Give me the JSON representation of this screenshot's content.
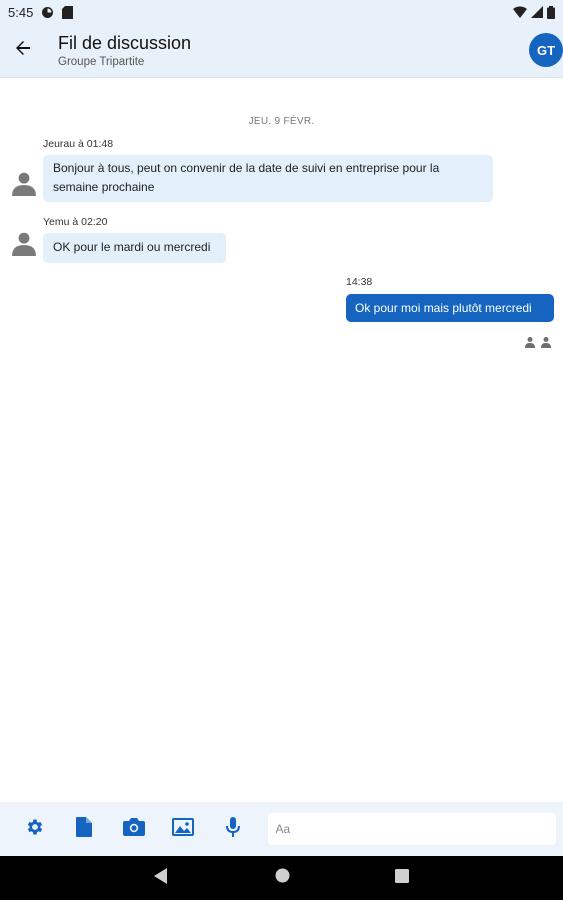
{
  "status_bar": {
    "time": "5:45"
  },
  "header": {
    "title": "Fil de discussion",
    "subtitle": "Groupe Tripartite",
    "avatar_initials": "GT"
  },
  "chat": {
    "date_divider": "JEU. 9 FÉVR.",
    "messages": [
      {
        "direction": "incoming",
        "meta": "Jeurau à 01:48",
        "text": "Bonjour à tous, peut on convenir de la date de suivi en entreprise pour la semaine prochaine"
      },
      {
        "direction": "incoming",
        "meta": "Yemu à 02:20",
        "text": "OK pour le mardi ou mercredi"
      },
      {
        "direction": "outgoing",
        "meta": "14:38",
        "text": "Ok pour moi mais plutôt mercredi"
      }
    ]
  },
  "composer": {
    "placeholder": "Aa",
    "tools": [
      "settings-icon",
      "file-icon",
      "camera-icon",
      "image-icon",
      "microphone-icon"
    ]
  },
  "colors": {
    "accent": "#1565c0",
    "header_bg": "#e8f0f9",
    "incoming_bubble": "#e3effb",
    "outgoing_bubble": "#1565c0"
  }
}
